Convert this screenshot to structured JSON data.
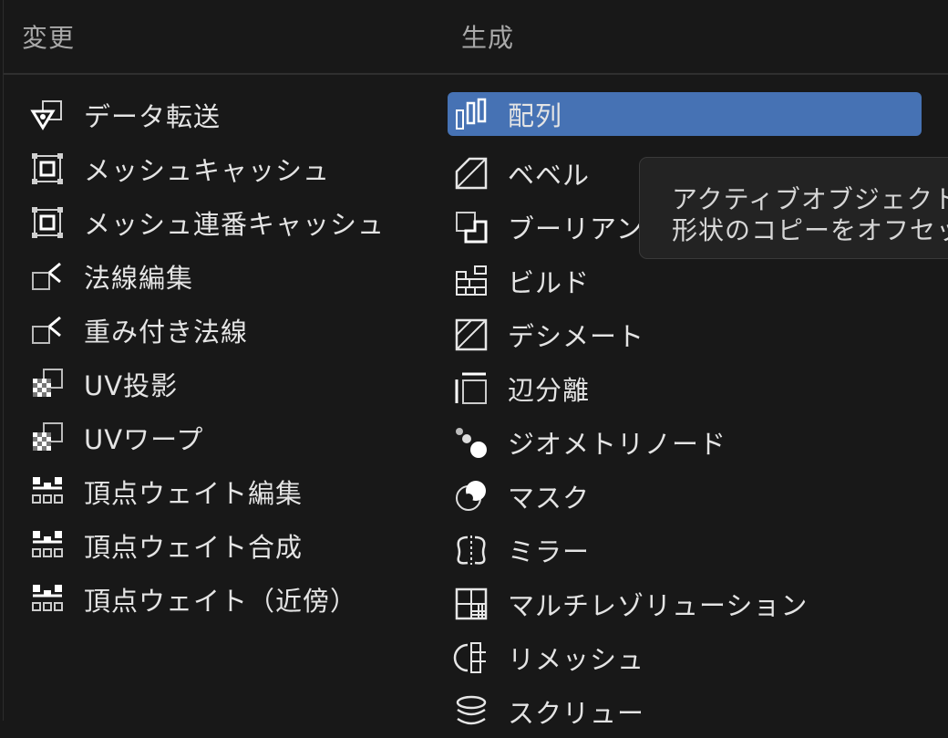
{
  "headers": {
    "left": "変更",
    "right": "生成"
  },
  "left_items": [
    {
      "label": "データ転送",
      "icon": "data-transfer-icon"
    },
    {
      "label": "メッシュキャッシュ",
      "icon": "mesh-cache-icon"
    },
    {
      "label": "メッシュ連番キャッシュ",
      "icon": "mesh-sequence-cache-icon"
    },
    {
      "label": "法線編集",
      "icon": "normal-edit-icon"
    },
    {
      "label": "重み付き法線",
      "icon": "weighted-normal-icon"
    },
    {
      "label": "UV投影",
      "icon": "uv-project-icon"
    },
    {
      "label": "UVワープ",
      "icon": "uv-warp-icon"
    },
    {
      "label": "頂点ウェイト編集",
      "icon": "vertex-weight-edit-icon"
    },
    {
      "label": "頂点ウェイト合成",
      "icon": "vertex-weight-mix-icon"
    },
    {
      "label": "頂点ウェイト（近傍）",
      "icon": "vertex-weight-proximity-icon"
    }
  ],
  "right_items": [
    {
      "label": "配列",
      "icon": "array-icon",
      "active": true
    },
    {
      "label": "ベベル",
      "icon": "bevel-icon"
    },
    {
      "label": "ブーリアン",
      "icon": "boolean-icon"
    },
    {
      "label": "ビルド",
      "icon": "build-icon"
    },
    {
      "label": "デシメート",
      "icon": "decimate-icon"
    },
    {
      "label": "辺分離",
      "icon": "edge-split-icon"
    },
    {
      "label": "ジオメトリノード",
      "icon": "geometry-nodes-icon"
    },
    {
      "label": "マスク",
      "icon": "mask-icon"
    },
    {
      "label": "ミラー",
      "icon": "mirror-icon"
    },
    {
      "label": "マルチレゾリューション",
      "icon": "multiresolution-icon"
    },
    {
      "label": "リメッシュ",
      "icon": "remesh-icon"
    },
    {
      "label": "スクリュー",
      "icon": "screw-icon"
    }
  ],
  "tooltip": {
    "line1": "アクティブオブジェクト",
    "line2": "形状のコピーをオフセッ"
  },
  "colors": {
    "accent": "#4672b4",
    "background": "#181818",
    "text": "#e4e4e4"
  }
}
